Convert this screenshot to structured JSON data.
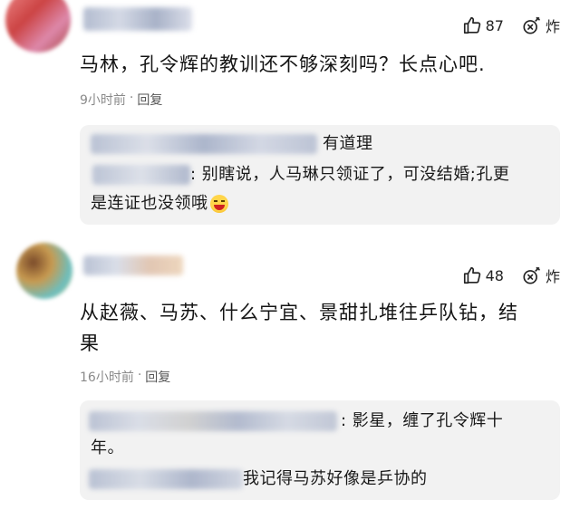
{
  "comments": [
    {
      "text": "马林，孔令辉的教训还不够深刻吗？长点心吧.",
      "likes": "87",
      "blast": "炸",
      "time": "9小时前",
      "dot": "·",
      "reply": "回复",
      "replies": [
        {
          "text": "有道理"
        },
        {
          "text": ": 别瞎说，人马琳只领证了，可没结婚;孔更"
        },
        {
          "text": "是连证也没领哦"
        }
      ]
    },
    {
      "text1": "从赵薇、马苏、什么宁宜、景甜扎堆往乒队钻，结",
      "text2": "果",
      "likes": "48",
      "blast": "炸",
      "time": "16小时前",
      "dot": "·",
      "reply": "回复",
      "replies": [
        {
          "text": ": 影星，缠了孔令辉十"
        },
        {
          "text": "年。"
        },
        {
          "text": "我记得马苏好像是乒协的"
        }
      ]
    }
  ],
  "icons": {
    "like": "thumb-up-icon",
    "blast": "bomb-icon",
    "emoji": "laughing-emoji-icon"
  }
}
